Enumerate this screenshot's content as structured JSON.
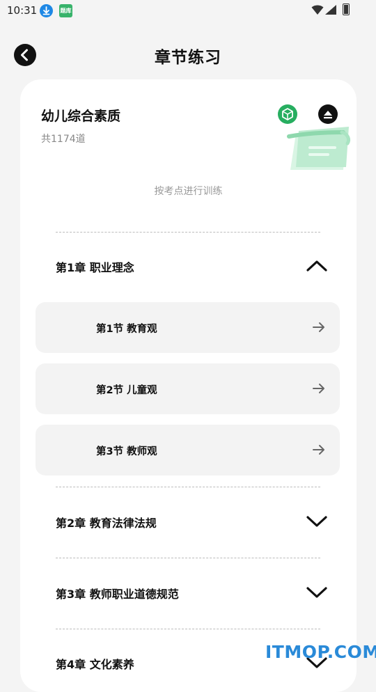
{
  "status_bar": {
    "time": "10:31",
    "app_badge": "题库"
  },
  "header": {
    "title": "章节练习"
  },
  "subject": {
    "title": "幼儿综合素质",
    "count": "共1174道"
  },
  "mode_hint": "按考点进行训练",
  "chapters": [
    {
      "label": "第1章 职业理念",
      "expanded": true,
      "sections": [
        {
          "label": "第1节 教育观"
        },
        {
          "label": "第2节 儿童观"
        },
        {
          "label": "第3节 教师观"
        }
      ]
    },
    {
      "label": "第2章 教育法律法规",
      "expanded": false
    },
    {
      "label": "第3章 教师职业道德规范",
      "expanded": false
    },
    {
      "label": "第4章 文化素养",
      "expanded": false
    }
  ],
  "icons": {
    "back": "back-arrow-icon",
    "collapse": "collapse-up-icon",
    "badge": "cube-badge-icon",
    "section_arrow": "arrow-right-icon",
    "chapter_toggle_open": "chevron-up-icon",
    "chapter_toggle_closed": "chevron-down-icon"
  },
  "colors": {
    "badge_green": "#27ae60",
    "watermark_blue": "#2a8ad8"
  },
  "watermark": "ITMOP.COM"
}
